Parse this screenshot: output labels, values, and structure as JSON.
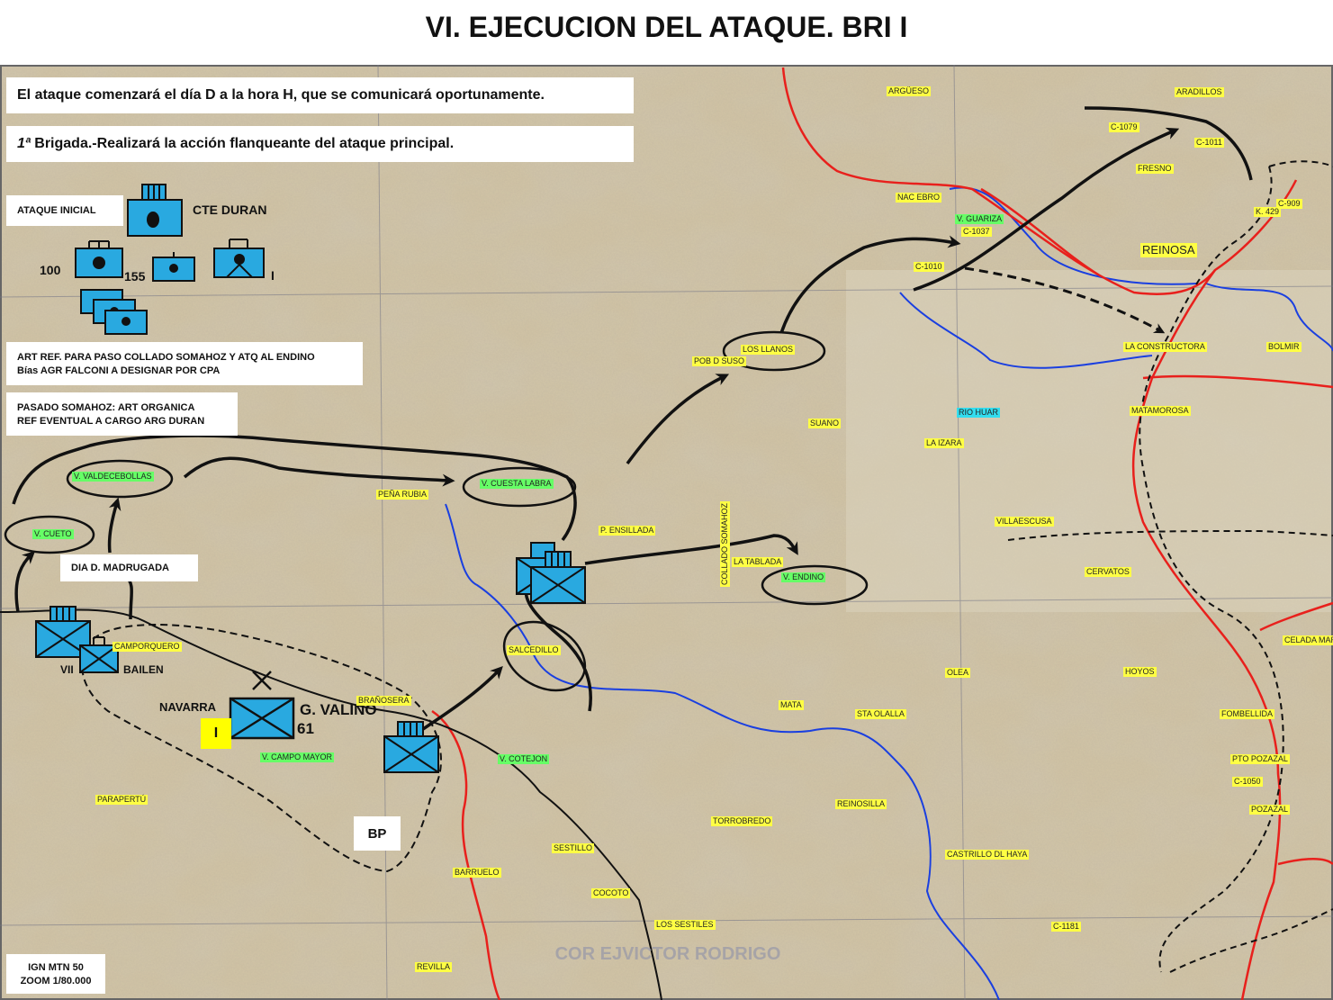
{
  "title": "VI. EJECUCION DEL ATAQUE. BRI I",
  "notes": {
    "line1": "El ataque comenzará el día D a la hora H, que se comunicará oportunamente.",
    "line2_prefix": "1ª",
    "line2_rest": " Brigada.-Realizará la acción flanqueante del ataque principal.",
    "ataque_inicial": "ATAQUE INICIAL",
    "cte_duran": "CTE DURAN",
    "art_ref_1": "ART REF. PARA PASO COLLADO SOMAHOZ Y ATQ AL ENDINO",
    "art_ref_2": "Bías AGR FALCONI A DESIGNAR POR CPA",
    "pasado_1": "PASADO SOMAHOZ: ART ORGANICA",
    "pasado_2": "REF EVENTUAL A CARGO ARG DURAN",
    "dia_d": "DIA D. MADRUGADA",
    "bp": "BP",
    "ign_1": "IGN MTN 50",
    "ign_2": "ZOOM 1/80.000",
    "watermark": "COR EJVICTOR RODRIGO"
  },
  "unit_labels": {
    "u100": "100",
    "u155": "155",
    "uI_art": "I",
    "vii": "VII",
    "bailen": "BAILEN",
    "navarra": "NAVARRA",
    "navarra_badge": "I",
    "g_valino": "G. VALIÑO",
    "n61": "61"
  },
  "places_yellow": [
    "ARGÜESO",
    "ARADILLOS",
    "C-1079",
    "C-1011",
    "FRESNO",
    "NAC EBRO",
    "C-1037",
    "C-909",
    "K. 429",
    "REINOSA",
    "C-1010",
    "LOS LLANOS",
    "POB D SUSO",
    "LA CONSTRUCTORA",
    "BOLMIR",
    "MATAMOROSA",
    "SUANO",
    "LA IZARA",
    "PEÑA RUBIA",
    "P. ENSILLADA",
    "LA TABLADA",
    "VILLAESCUSA",
    "CERVATOS",
    "CAMPORQUERO",
    "OLEA",
    "HOYOS",
    "CELADA MARLANTES",
    "MATA",
    "STA OLALLA",
    "FOMBELLIDA",
    "PTO POZAZAL",
    "C-1050",
    "POZAZAL",
    "PARAPERTÚ",
    "REINOSILLA",
    "TORROBREDO",
    "SESTILLO",
    "CASTRILLO DL HAYA",
    "BARRUELO",
    "COCOTO",
    "LOS SESTILES",
    "C-1181",
    "REVILLA",
    "BRAÑOSERA"
  ],
  "places_green": [
    "V. GUARIZA",
    "V. VALDECEBOLLAS",
    "V. CUESTA LABRA",
    "V. CUETO",
    "V. ENDINO",
    "V. CAMPO MAYOR",
    "V. COTEJON",
    "SALCEDILLO"
  ],
  "places_cyan": [
    "RIO HUAR"
  ],
  "vertical_label": "COLLADO SOMAHOZ",
  "colors": {
    "unit_fill": "#29a9e0",
    "road_red": "#e8201c",
    "river_blue": "#1a3fe0",
    "yellow": "#ffff44",
    "green": "#66ff66",
    "map_base": "#cdbf9f"
  }
}
